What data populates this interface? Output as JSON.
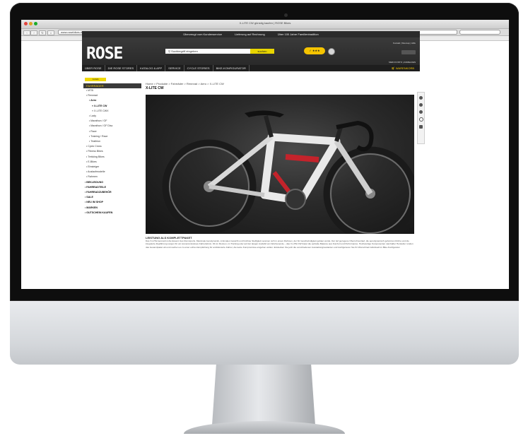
{
  "browser": {
    "window_title": "X-LITE CW günstig kaufen | ROSE Bikes",
    "url": "www.rosebikes.de"
  },
  "site": {
    "promo_bar": [
      "Überzeugt vom Kundenservice",
      "Lieferung auf Rechnung",
      "Über 100 Jahre Familientradition"
    ],
    "logo_text": "ROSE",
    "search_placeholder": "Suchbegriff eingeben",
    "search_button": "suchen",
    "header_links": "Kontakt | Sitemap | Hilfe",
    "login_link": "MEIN KONTO | ANMELDEN",
    "main_nav": [
      "ÜBER ROSE",
      "DIE ROSE STORES",
      "KATALOG & APP",
      "SERVICE",
      "CYCLE STORIES",
      "BIKE-KONFIGURATOR"
    ],
    "cart_label": "WARENKORB"
  },
  "sidebar": {
    "back_label": "zurück",
    "category_header": "FAHRRÄDER",
    "items": [
      "• MTB",
      "• Rennrad",
      "• Aero",
      "» X-LITE CW",
      "» X-LITE CWX",
      "• Lady",
      "• Marathon / GF",
      "• Marathon / GF Disc",
      "• Race",
      "• Training / Race",
      "• Triathlon",
      "• Cyclo Cross",
      "• Fitness Bikes",
      "• Trekking Bikes",
      "• E-Bikes",
      "• Einsteiger",
      "• Auslaufmodelle",
      "• Rahmen",
      "• BEKLEIDUNG",
      "• FAHRRADTEILE",
      "• FAHRRADZUBEHÖR",
      "• SALE",
      "• NEU IM SHOP",
      "• MARKEN",
      "• GUTSCHEIN KAUFEN"
    ]
  },
  "content": {
    "breadcrumb": "Home > Produkte > Fahrräder > Rennrad > Aero > X-LITE CW",
    "title": "X-LITE CW",
    "section_heading": "LEISTUNG ALS KOMPLETTPAKET",
    "body": "Das X-LITE Aerorad ist die Essenz des Rennsports. Maximale Aerodynamik, minimales Gewicht und höchste Steifigkeit vereinen sich in einem Rahmen, der für Geschwindigkeit gebaut wurde. Der tief gezogene Oberrohrverlauf, die aerodynamisch geformten Rohre und die integrierte Zugführung sorgen für ein kompromissloses Fahrerlebnis. Ob im Rennen, im Training oder auf der langen Ausfahrt am Wochenende – das X-LITE CW bietet die perfekte Balance aus Komfort und Performance. Hochwertige Komponenten namhafter Hersteller runden das Gesamtpaket ab und machen es zu einer echten Empfehlung für ambitionierte Fahrer, die keine Kompromisse eingehen wollen. Entdecken Sie jetzt die verschiedenen Ausstattungsvarianten und konfigurieren Sie Ihr Wunschrad individuell im Bike-Konfigurator."
  },
  "colors": {
    "accent_yellow": "#f0c400",
    "header_dark": "#2b2b2b",
    "bike_red": "#c4232b"
  }
}
